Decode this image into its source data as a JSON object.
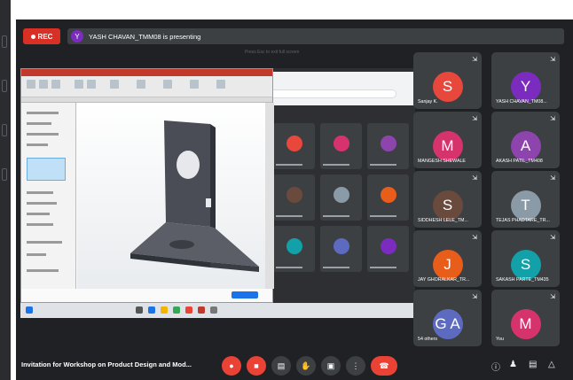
{
  "recording": {
    "label": "REC"
  },
  "presenter_banner": {
    "avatar_initial": "Y",
    "text": "YASH CHAVAN_TMM08 is presenting"
  },
  "hint": "Press Esc to exit full screen",
  "colors": {
    "meet_bg": "#202124",
    "tile_bg": "#3c4043",
    "rec_red": "#d93025",
    "end_call_red": "#ea4335"
  },
  "participants": [
    {
      "initial": "S",
      "name": "Sanjay K.",
      "color": "#e8473c"
    },
    {
      "initial": "Y",
      "name": "YASH CHAVAN_TM08...",
      "color": "#7b2cbf"
    },
    {
      "initial": "M",
      "name": "MANGESH SHEWALE",
      "color": "#d6336c"
    },
    {
      "initial": "A",
      "name": "AKASH PATIL_TM408",
      "color": "#8e44ad"
    },
    {
      "initial": "S",
      "name": "SIDDHESH LELE_TM...",
      "color": "#6b4a3e"
    },
    {
      "initial": "T",
      "name": "TEJAS PHADTARE_TR...",
      "color": "#8a9aa6"
    },
    {
      "initial": "J",
      "name": "JAY GHORALKAR_TR...",
      "color": "#e85d1a"
    },
    {
      "initial": "S",
      "name": "SAKASH PARTE_TM435",
      "color": "#12a1a8"
    },
    {
      "initial": "G A",
      "name": "54 others",
      "color": "#5c6bc0"
    },
    {
      "initial": "M",
      "name": "You",
      "color": "#d6336c"
    }
  ],
  "mini_tiles": [
    {
      "color": "#e8473c"
    },
    {
      "color": "#d6336c"
    },
    {
      "color": "#8e44ad"
    },
    {
      "color": "#6b4a3e"
    },
    {
      "color": "#8a9aa6"
    },
    {
      "color": "#e85d1a"
    },
    {
      "color": "#12a1a8"
    },
    {
      "color": "#5c6bc0"
    },
    {
      "color": "#7b2cbf"
    }
  ],
  "meeting_title": "Invitation for Workshop on Product Design and Mod...",
  "controls": [
    "mic-off",
    "camera-off",
    "captions",
    "raise-hand",
    "present",
    "more-options",
    "end-call"
  ],
  "right_controls": [
    "info",
    "people",
    "chat",
    "activities"
  ]
}
